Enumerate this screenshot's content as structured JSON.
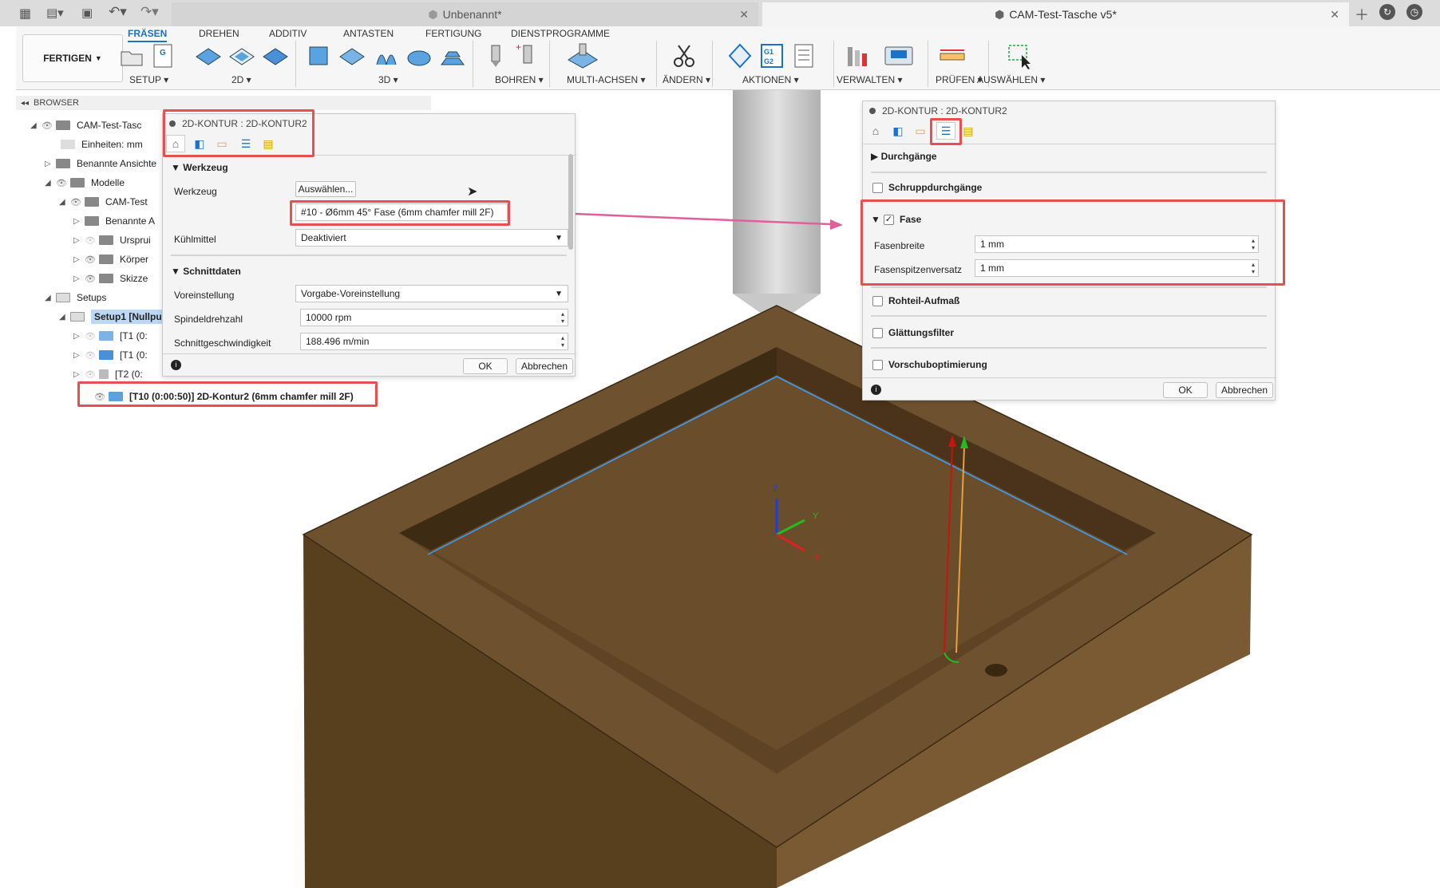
{
  "tabs": [
    {
      "label": "Unbenannt*"
    },
    {
      "label": "CAM-Test-Tasche v5*"
    }
  ],
  "ribbon": {
    "fertigen_label": "FERTIGEN",
    "tabs": [
      "FRÄSEN",
      "DREHEN",
      "ADDITIV",
      "ANTASTEN",
      "FERTIGUNG",
      "DIENSTPROGRAMME"
    ],
    "groups": [
      "SETUP",
      "2D",
      "3D",
      "BOHREN",
      "MULTI-ACHSEN",
      "ÄNDERN",
      "AKTIONEN",
      "VERWALTEN",
      "PRÜFEN",
      "AUSWÄHLEN"
    ]
  },
  "browser": {
    "title": "BROWSER",
    "items": [
      "CAM-Test-Tasc",
      "Einheiten: mm",
      "Benannte Ansichte",
      "Modelle",
      "CAM-Test",
      "Benannte A",
      "Ursprui",
      "Körper",
      "Skizze",
      "Setups",
      "Setup1 [Nullpu",
      "[T1 (0:",
      "[T1 (0:",
      "[T2 (0:",
      "[T10 (0:00:50)] 2D-Kontur2 (6mm chamfer mill 2F)"
    ]
  },
  "dialog_left": {
    "title": "2D-KONTUR : 2D-KONTUR2",
    "sec_tool": "Werkzeug",
    "tool_label": "Werkzeug",
    "select_btn": "Auswählen...",
    "tool_value": "#10 - Ø6mm 45° Fase (6mm chamfer mill 2F)",
    "coolant_label": "Kühlmittel",
    "coolant_value": "Deaktiviert",
    "sec_cut": "Schnittdaten",
    "preset_label": "Voreinstellung",
    "preset_value": "Vorgabe-Voreinstellung",
    "spindle_label": "Spindeldrehzahl",
    "spindle_value": "10000 rpm",
    "speed_label": "Schnittgeschwindigkeit",
    "speed_value": "188.496 m/min",
    "ok": "OK",
    "cancel": "Abbrechen"
  },
  "dialog_right": {
    "title": "2D-KONTUR : 2D-KONTUR2",
    "passes": "Durchgänge",
    "rough": "Schruppdurchgänge",
    "chamfer": "Fase",
    "width_label": "Fasenbreite",
    "width_value": "1 mm",
    "offset_label": "Fasenspitzenversatz",
    "offset_value": "1 mm",
    "stock": "Rohteil-Aufmaß",
    "smoothing": "Glättungsfilter",
    "feed": "Vorschuboptimierung",
    "ok": "OK",
    "cancel": "Abbrechen"
  },
  "axes": {
    "z": "Z",
    "y": "Y",
    "x": "X"
  },
  "colors": {
    "accent": "#1a73c8",
    "highlight": "#e85050",
    "part": "#6e5230"
  }
}
